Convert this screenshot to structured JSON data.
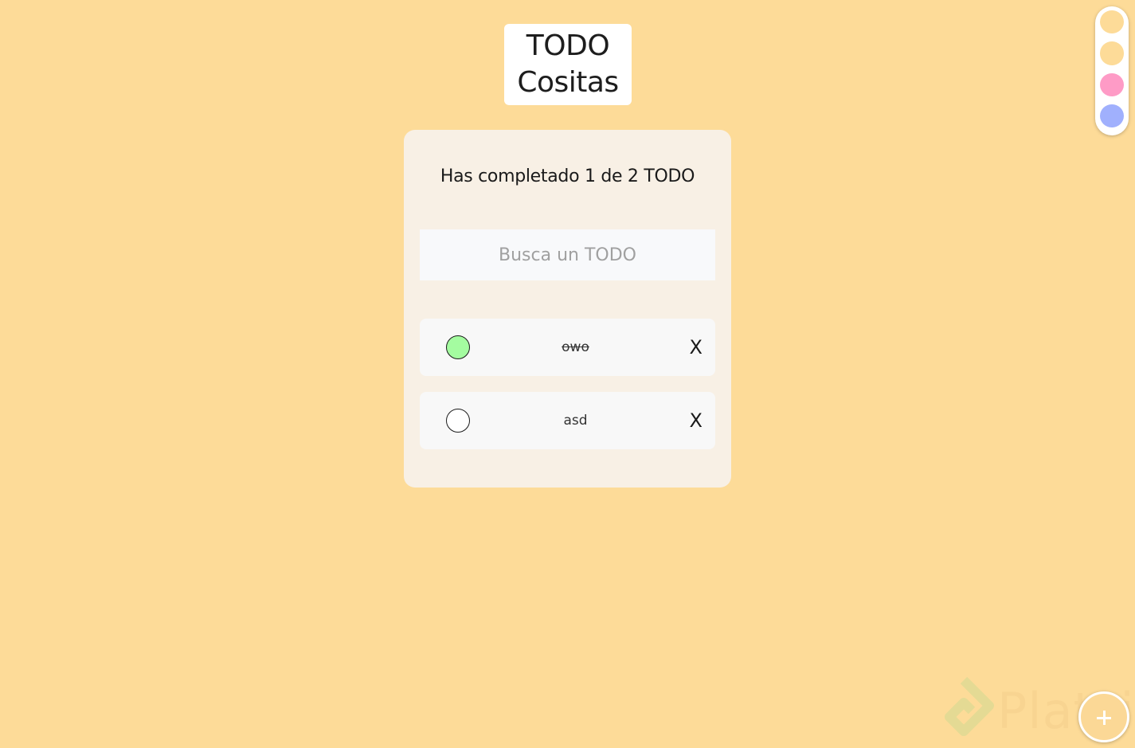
{
  "header": {
    "title_line1": "TODO",
    "title_line2": "Cositas"
  },
  "counter": {
    "text": "Has completado 1 de 2 TODO"
  },
  "search": {
    "placeholder": "Busca un TODO",
    "value": ""
  },
  "todos": [
    {
      "text": "owo",
      "completed": true,
      "delete_label": "X"
    },
    {
      "text": "asd",
      "completed": false,
      "delete_label": "X"
    }
  ],
  "theme_colors": [
    "#fddb98",
    "#fddb98",
    "#fe9bc6",
    "#a0b0fd"
  ],
  "colors": {
    "background": "#fddb98",
    "card": "#f8f0e5",
    "check_done": "#a4fca0"
  },
  "watermark": {
    "text": "Platzi"
  },
  "add_button": {
    "icon": "plus-icon"
  }
}
